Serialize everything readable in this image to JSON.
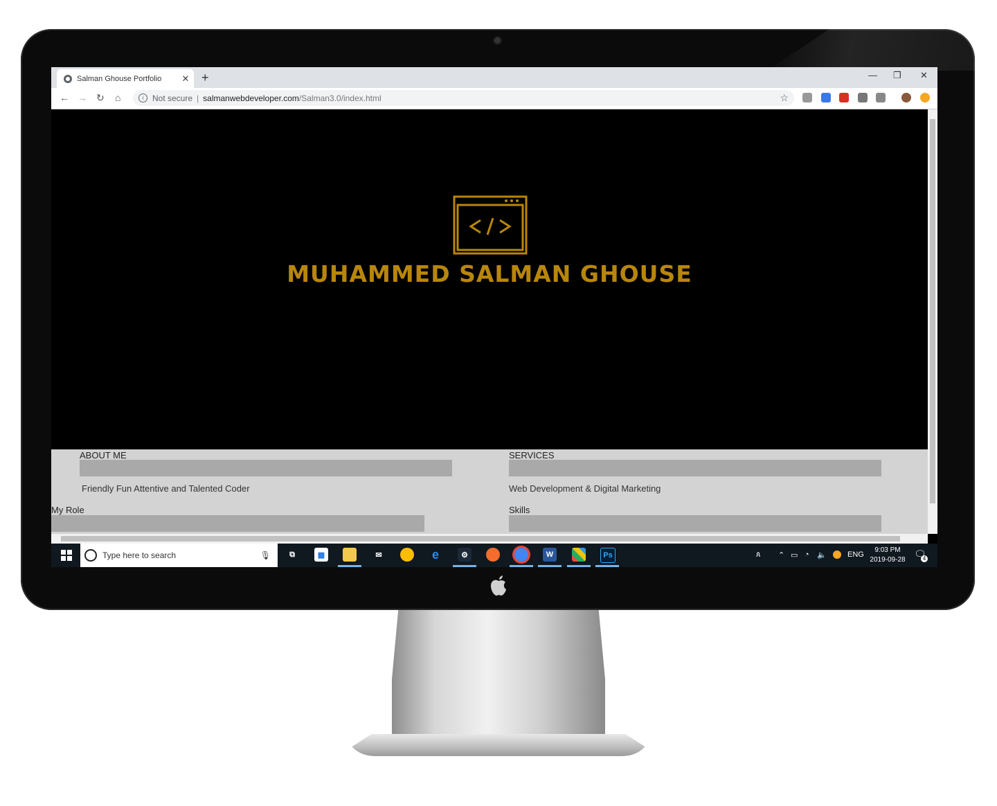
{
  "browser": {
    "tab_title": "Salman Ghouse Portfolio",
    "tab_close": "✕",
    "new_tab": "+",
    "window_controls": {
      "minimize": "—",
      "maximize": "❐",
      "close": "✕"
    },
    "security_label": "Not secure",
    "url_host": "salmanwebdeveloper.com",
    "url_path": "/Salman3.0/index.html",
    "nav": {
      "back": "←",
      "forward": "→",
      "reload": "↻",
      "home": "⌂"
    },
    "bookmark_star": "☆"
  },
  "hero": {
    "name": "MUHAMMED SALMAN GHOUSE",
    "logo_icon": "code-window-icon",
    "accent_color": "#b8860b"
  },
  "sections": {
    "about": {
      "label": "ABOUT ME",
      "text": "Friendly Fun Attentive and Talented Coder"
    },
    "services": {
      "label": "SERVICES",
      "text": "Web Development & Digital Marketing"
    },
    "role": {
      "label": "My Role"
    },
    "skills": {
      "label": "Skills"
    }
  },
  "taskbar": {
    "search_placeholder": "Type here to search",
    "language": "ENG",
    "time": "9:03 PM",
    "date": "2019-09-28",
    "notification_count": "4",
    "apps": [
      "task-view",
      "store",
      "file-explorer",
      "mail",
      "chrome-canary",
      "edge",
      "steam",
      "origin",
      "chrome",
      "word",
      "windows-media",
      "photoshop"
    ]
  }
}
